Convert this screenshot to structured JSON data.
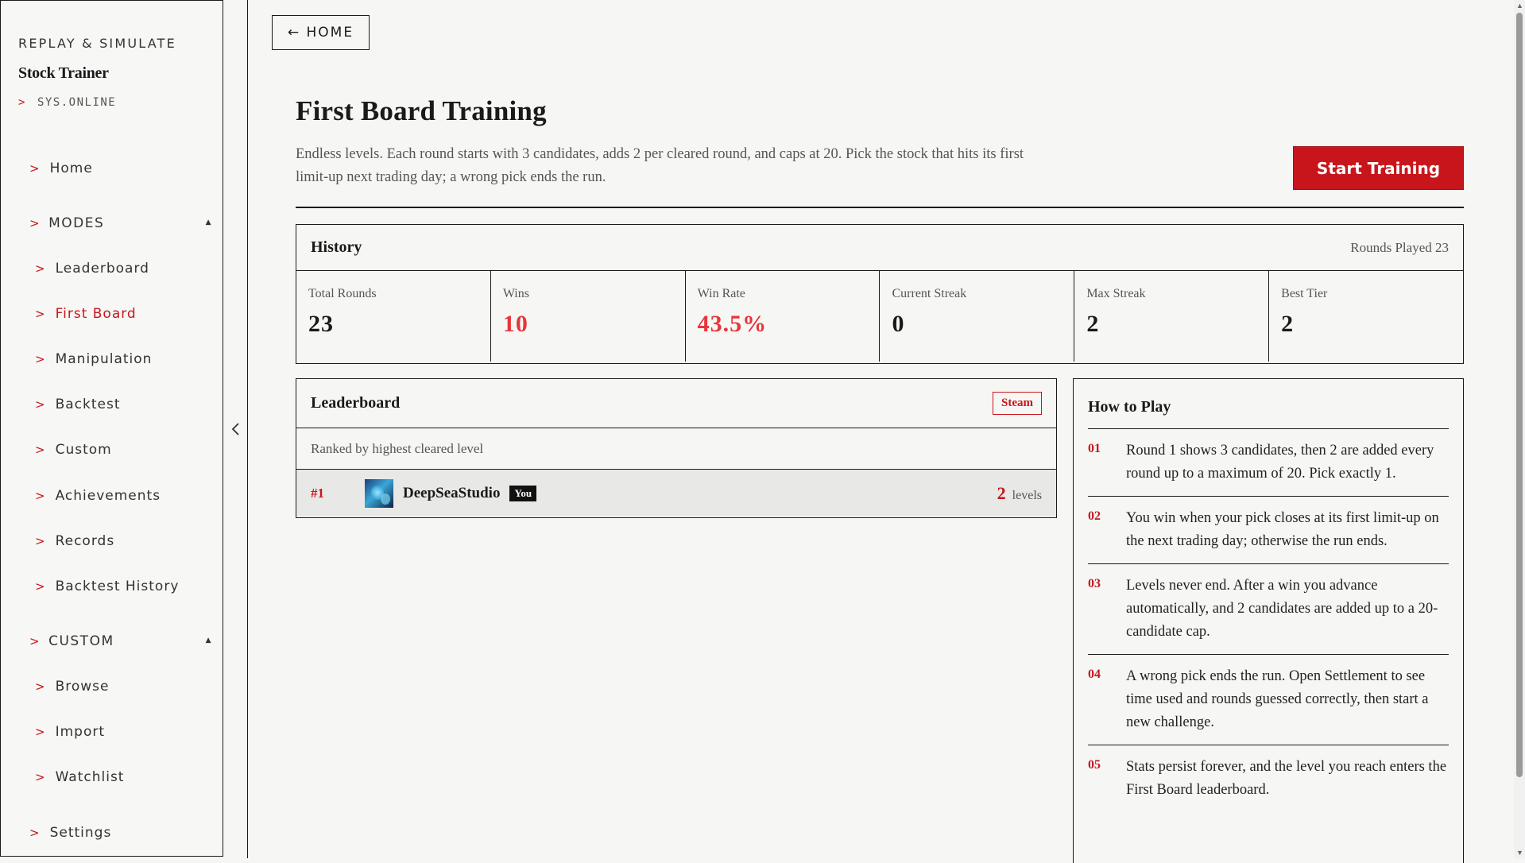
{
  "sidebar": {
    "kicker": "REPLAY & SIMULATE",
    "brand": "Stock Trainer",
    "status_caret": ">",
    "status": "SYS.ONLINE",
    "caret": ">",
    "home": "Home",
    "modes_label": "MODES",
    "modes": [
      "Leaderboard",
      "First Board",
      "Manipulation",
      "Backtest",
      "Custom",
      "Achievements",
      "Records",
      "Backtest History"
    ],
    "custom_label": "CUSTOM",
    "custom": [
      "Browse",
      "Import",
      "Watchlist"
    ],
    "settings": "Settings",
    "active_item": "First Board"
  },
  "header": {
    "home_button": "← HOME",
    "title": "First Board Training",
    "description": "Endless levels. Each round starts with 3 candidates, adds 2 per cleared round, and caps at 20. Pick the stock that hits its first limit-up next trading day; a wrong pick ends the run.",
    "start_button": "Start Training"
  },
  "history": {
    "title": "History",
    "rounds_played": "Rounds Played 23",
    "stats": [
      {
        "label": "Total Rounds",
        "value": "23",
        "highlight": false
      },
      {
        "label": "Wins",
        "value": "10",
        "highlight": true
      },
      {
        "label": "Win Rate",
        "value": "43.5%",
        "highlight": true
      },
      {
        "label": "Current Streak",
        "value": "0",
        "highlight": false
      },
      {
        "label": "Max Streak",
        "value": "2",
        "highlight": false
      },
      {
        "label": "Best Tier",
        "value": "2",
        "highlight": false
      }
    ]
  },
  "leaderboard": {
    "title": "Leaderboard",
    "badge": "Steam",
    "subtitle": "Ranked by highest cleared level",
    "entries": [
      {
        "rank": "#1",
        "name": "DeepSeaStudio",
        "you_tag": "You",
        "score": "2",
        "unit": "levels"
      }
    ]
  },
  "howto": {
    "title": "How to Play",
    "steps": [
      {
        "n": "01",
        "text": "Round 1 shows 3 candidates, then 2 are added every round up to a maximum of 20. Pick exactly 1."
      },
      {
        "n": "02",
        "text": "You win when your pick closes at its first limit-up on the next trading day; otherwise the run ends."
      },
      {
        "n": "03",
        "text": "Levels never end. After a win you advance automatically, and 2 candidates are added up to a 20-candidate cap."
      },
      {
        "n": "04",
        "text": "A wrong pick ends the run. Open Settlement to see time used and rounds guessed correctly, then start a new challenge."
      },
      {
        "n": "05",
        "text": "Stats persist forever, and the level you reach enters the First Board leaderboard."
      }
    ]
  },
  "colors": {
    "accent": "#c8151b",
    "highlight_value": "#e8353a",
    "ink": "#1a1a1a",
    "background": "#f6f6f4"
  },
  "icons": {
    "collapse": "chevron-left-icon",
    "section_toggle": "triangle-up-icon"
  }
}
